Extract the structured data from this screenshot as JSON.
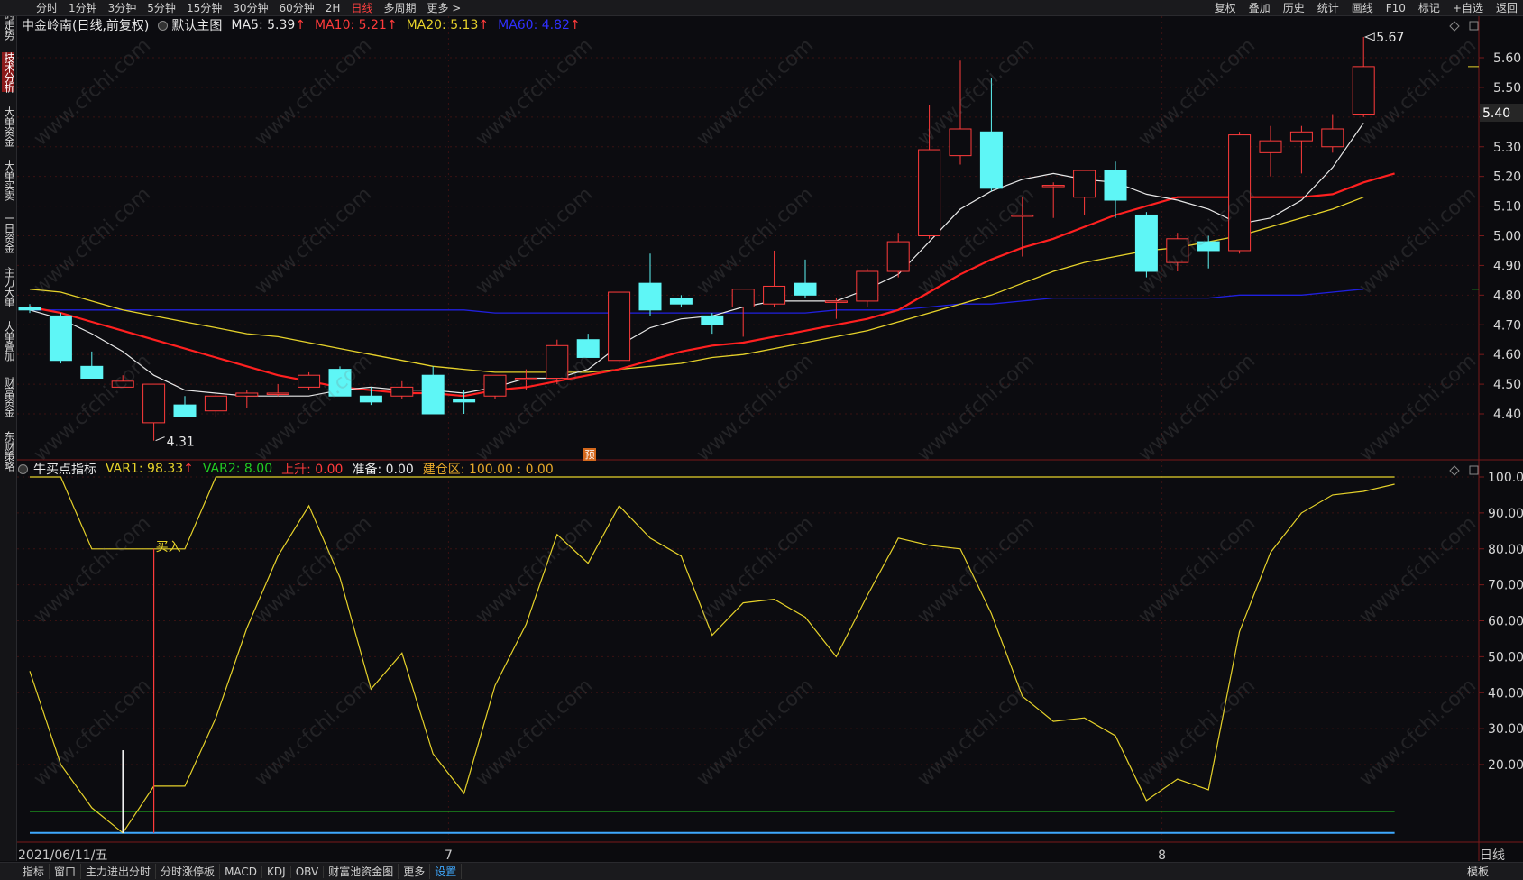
{
  "left_sidebar": [
    {
      "label": "分时走势",
      "active": false
    },
    {
      "label": "技术分析",
      "active": true
    },
    {
      "label": "大单资金",
      "active": false
    },
    {
      "label": "大单买卖",
      "active": false
    },
    {
      "label": "一日资金",
      "active": false
    },
    {
      "label": "主力大单",
      "active": false
    },
    {
      "label": "大单叠加",
      "active": false
    },
    {
      "label": "财富资金",
      "active": false
    },
    {
      "label": "东财策略",
      "active": false
    }
  ],
  "top_tabs": [
    {
      "label": "分时",
      "active": false
    },
    {
      "label": "1分钟",
      "active": false
    },
    {
      "label": "3分钟",
      "active": false
    },
    {
      "label": "5分钟",
      "active": false
    },
    {
      "label": "15分钟",
      "active": false
    },
    {
      "label": "30分钟",
      "active": false
    },
    {
      "label": "60分钟",
      "active": false
    },
    {
      "label": "2H",
      "active": false
    },
    {
      "label": "日线",
      "active": true
    },
    {
      "label": "多周期",
      "active": false
    },
    {
      "label": "更多 >",
      "active": false
    }
  ],
  "top_right": [
    "复权",
    "叠加",
    "历史",
    "统计",
    "画线",
    "F10",
    "标记",
    "+自选",
    "返回"
  ],
  "main_header": {
    "title": "中金岭南(日线,前复权)",
    "template": "默认主图",
    "ma5": "MA5: 5.39",
    "ma10": "MA10: 5.21",
    "ma20": "MA20: 5.13",
    "ma60": "MA60: 4.82",
    "arrow": "↑"
  },
  "indicator_header": {
    "name": "牛买点指标",
    "var1": "VAR1: 98.33",
    "var2": "VAR2: 8.00",
    "up": "上升: 0.00",
    "prep": "准备: 0.00",
    "build": "建仓区: 100.00 : 0.00",
    "arrow": "↑"
  },
  "annotations": {
    "high_label": "5.67",
    "low_label": "4.31",
    "current_price": "5.40",
    "pred_tag": "预",
    "buy_label": "买入"
  },
  "x_axis": {
    "start_date": "2021/06/11/五",
    "month_labels": [
      "7",
      "8"
    ],
    "period": "日线"
  },
  "bottom_tabs": [
    {
      "label": "指标",
      "active": false
    },
    {
      "label": "窗口",
      "active": false
    },
    {
      "label": "主力进出分时",
      "active": false
    },
    {
      "label": "分时涨停板",
      "active": false
    },
    {
      "label": "MACD",
      "active": false
    },
    {
      "label": "KDJ",
      "active": false
    },
    {
      "label": "OBV",
      "active": false
    },
    {
      "label": "财富池资金图",
      "active": false
    },
    {
      "label": "更多",
      "active": false
    },
    {
      "label": "设置",
      "active": true
    }
  ],
  "bottom_right": "模板",
  "watermark": "www.cfchi.com",
  "colors": {
    "up": "#ff3b3b",
    "down": "#5ef6f6",
    "ma5": "#e8e8e8",
    "ma10": "#ff2020",
    "ma20": "#e6d22a",
    "ma60": "#2020e0",
    "var1": "#e6d22a",
    "var2": "#22cc22",
    "build": "#3fa9ff"
  },
  "chart_data": [
    {
      "type": "candlestick",
      "title": "中金岭南(日线,前复权)",
      "y_ticks": [
        "5.60",
        "5.50",
        "5.40",
        "5.30",
        "5.20",
        "5.10",
        "5.00",
        "4.90",
        "4.80",
        "4.70",
        "4.60",
        "4.50",
        "4.40"
      ],
      "ylim": [
        4.25,
        5.7
      ],
      "candles": [
        {
          "o": 4.76,
          "h": 4.77,
          "l": 4.74,
          "c": 4.75
        },
        {
          "o": 4.73,
          "h": 4.74,
          "l": 4.57,
          "c": 4.58
        },
        {
          "o": 4.56,
          "h": 4.61,
          "l": 4.52,
          "c": 4.52
        },
        {
          "o": 4.49,
          "h": 4.53,
          "l": 4.49,
          "c": 4.51
        },
        {
          "o": 4.37,
          "h": 4.5,
          "l": 4.31,
          "c": 4.5
        },
        {
          "o": 4.43,
          "h": 4.46,
          "l": 4.39,
          "c": 4.39
        },
        {
          "o": 4.41,
          "h": 4.47,
          "l": 4.39,
          "c": 4.46
        },
        {
          "o": 4.46,
          "h": 4.48,
          "l": 4.42,
          "c": 4.47
        },
        {
          "o": 4.47,
          "h": 4.5,
          "l": 4.46,
          "c": 4.47
        },
        {
          "o": 4.49,
          "h": 4.54,
          "l": 4.48,
          "c": 4.53
        },
        {
          "o": 4.55,
          "h": 4.56,
          "l": 4.46,
          "c": 4.46
        },
        {
          "o": 4.46,
          "h": 4.49,
          "l": 4.43,
          "c": 4.44
        },
        {
          "o": 4.46,
          "h": 4.51,
          "l": 4.45,
          "c": 4.49
        },
        {
          "o": 4.53,
          "h": 4.56,
          "l": 4.4,
          "c": 4.4
        },
        {
          "o": 4.45,
          "h": 4.48,
          "l": 4.4,
          "c": 4.44
        },
        {
          "o": 4.46,
          "h": 4.52,
          "l": 4.45,
          "c": 4.53
        },
        {
          "o": 4.52,
          "h": 4.55,
          "l": 4.48,
          "c": 4.52
        },
        {
          "o": 4.52,
          "h": 4.65,
          "l": 4.5,
          "c": 4.63
        },
        {
          "o": 4.65,
          "h": 4.67,
          "l": 4.59,
          "c": 4.59
        },
        {
          "o": 4.58,
          "h": 4.81,
          "l": 4.57,
          "c": 4.81
        },
        {
          "o": 4.84,
          "h": 4.94,
          "l": 4.73,
          "c": 4.75
        },
        {
          "o": 4.79,
          "h": 4.8,
          "l": 4.76,
          "c": 4.77
        },
        {
          "o": 4.73,
          "h": 4.74,
          "l": 4.67,
          "c": 4.7
        },
        {
          "o": 4.76,
          "h": 4.82,
          "l": 4.66,
          "c": 4.82
        },
        {
          "o": 4.77,
          "h": 4.95,
          "l": 4.76,
          "c": 4.83
        },
        {
          "o": 4.84,
          "h": 4.92,
          "l": 4.79,
          "c": 4.8
        },
        {
          "o": 4.78,
          "h": 4.79,
          "l": 4.72,
          "c": 4.78
        },
        {
          "o": 4.78,
          "h": 4.89,
          "l": 4.76,
          "c": 4.88
        },
        {
          "o": 4.88,
          "h": 5.01,
          "l": 4.86,
          "c": 4.98
        },
        {
          "o": 5.0,
          "h": 5.44,
          "l": 4.99,
          "c": 5.29
        },
        {
          "o": 5.27,
          "h": 5.59,
          "l": 5.24,
          "c": 5.36
        },
        {
          "o": 5.35,
          "h": 5.53,
          "l": 5.15,
          "c": 5.16
        },
        {
          "o": 5.07,
          "h": 5.13,
          "l": 4.93,
          "c": 5.07
        },
        {
          "o": 5.17,
          "h": 5.18,
          "l": 5.06,
          "c": 5.17
        },
        {
          "o": 5.13,
          "h": 5.22,
          "l": 5.07,
          "c": 5.22
        },
        {
          "o": 5.22,
          "h": 5.25,
          "l": 5.06,
          "c": 5.12
        },
        {
          "o": 5.07,
          "h": 5.08,
          "l": 4.86,
          "c": 4.88
        },
        {
          "o": 4.91,
          "h": 5.01,
          "l": 4.88,
          "c": 4.99
        },
        {
          "o": 4.98,
          "h": 5.0,
          "l": 4.89,
          "c": 4.95
        },
        {
          "o": 4.95,
          "h": 5.35,
          "l": 4.94,
          "c": 5.34
        },
        {
          "o": 5.28,
          "h": 5.37,
          "l": 5.2,
          "c": 5.32
        },
        {
          "o": 5.32,
          "h": 5.37,
          "l": 5.21,
          "c": 5.35
        },
        {
          "o": 5.3,
          "h": 5.41,
          "l": 5.28,
          "c": 5.36
        },
        {
          "o": 5.41,
          "h": 5.67,
          "l": 5.4,
          "c": 5.57
        }
      ],
      "ma5": [
        4.75,
        4.72,
        4.67,
        4.61,
        4.53,
        4.48,
        4.47,
        4.46,
        4.46,
        4.46,
        4.48,
        4.49,
        4.48,
        4.48,
        4.47,
        4.49,
        4.52,
        4.52,
        4.55,
        4.63,
        4.69,
        4.72,
        4.73,
        4.76,
        4.78,
        4.78,
        4.78,
        4.82,
        4.87,
        4.98,
        5.09,
        5.15,
        5.19,
        5.21,
        5.19,
        5.18,
        5.14,
        5.12,
        5.09,
        5.04,
        5.06,
        5.12,
        5.23,
        5.38
      ],
      "ma10": [
        4.76,
        4.74,
        4.71,
        4.68,
        4.65,
        4.62,
        4.59,
        4.56,
        4.53,
        4.51,
        4.49,
        4.48,
        4.47,
        4.47,
        4.46,
        4.48,
        4.49,
        4.51,
        4.53,
        4.55,
        4.58,
        4.61,
        4.63,
        4.64,
        4.66,
        4.68,
        4.7,
        4.72,
        4.75,
        4.81,
        4.87,
        4.92,
        4.96,
        4.99,
        5.03,
        5.07,
        5.1,
        5.13,
        5.13,
        5.13,
        5.13,
        5.13,
        5.14,
        5.18,
        5.21
      ],
      "ma20": [
        4.82,
        4.81,
        4.78,
        4.75,
        4.73,
        4.71,
        4.69,
        4.67,
        4.66,
        4.64,
        4.62,
        4.6,
        4.58,
        4.56,
        4.55,
        4.54,
        4.54,
        4.54,
        4.54,
        4.55,
        4.56,
        4.57,
        4.59,
        4.6,
        4.62,
        4.64,
        4.66,
        4.68,
        4.71,
        4.74,
        4.77,
        4.8,
        4.84,
        4.88,
        4.91,
        4.93,
        4.95,
        4.96,
        4.98,
        5.0,
        5.03,
        5.06,
        5.09,
        5.13
      ],
      "ma60": [
        4.75,
        4.75,
        4.75,
        4.75,
        4.75,
        4.75,
        4.75,
        4.75,
        4.75,
        4.75,
        4.75,
        4.75,
        4.75,
        4.75,
        4.75,
        4.74,
        4.74,
        4.74,
        4.74,
        4.74,
        4.74,
        4.74,
        4.74,
        4.74,
        4.74,
        4.74,
        4.75,
        4.75,
        4.75,
        4.76,
        4.77,
        4.77,
        4.78,
        4.79,
        4.79,
        4.79,
        4.79,
        4.79,
        4.79,
        4.8,
        4.8,
        4.8,
        4.81,
        4.82
      ]
    },
    {
      "type": "line",
      "title": "牛买点指标",
      "y_ticks": [
        "100.0",
        "90.00",
        "80.00",
        "70.00",
        "60.00",
        "50.00",
        "40.00",
        "30.00",
        "20.00"
      ],
      "ylim": [
        0,
        100
      ],
      "series": [
        {
          "name": "VAR1",
          "values": [
            46,
            20,
            8,
            1,
            14,
            14,
            33,
            58,
            78,
            92,
            72,
            41,
            51,
            23,
            12,
            42,
            59,
            84,
            76,
            92,
            83,
            78,
            56,
            65,
            66,
            61,
            50,
            67,
            83,
            81,
            80,
            62,
            39,
            32,
            33,
            28,
            10,
            16,
            13,
            57,
            79,
            90,
            95,
            96,
            98
          ]
        },
        {
          "name": "VAR2",
          "values": [
            7,
            7,
            7,
            7,
            7,
            7,
            7,
            7,
            7,
            7,
            7,
            7,
            7,
            7,
            7,
            7,
            7,
            7,
            7,
            7,
            7,
            7,
            7,
            7,
            7,
            7,
            7,
            7,
            7,
            7,
            7,
            7,
            7,
            7,
            7,
            7,
            7,
            7,
            7,
            7,
            7,
            7,
            7,
            7,
            7
          ]
        },
        {
          "name": "建仓区",
          "values": [
            0,
            0,
            0,
            0,
            0,
            0,
            0,
            0,
            0,
            0,
            0,
            0,
            0,
            0,
            0,
            0,
            0,
            0,
            0,
            0,
            0,
            0,
            0,
            0,
            0,
            0,
            0,
            0,
            0,
            0,
            0,
            0,
            0,
            0,
            0,
            0,
            0,
            0,
            0,
            0,
            0,
            0,
            0,
            0,
            0
          ]
        },
        {
          "name": "upper",
          "values": [
            100,
            100,
            80,
            80,
            80,
            80,
            100,
            100,
            100,
            100,
            100,
            100,
            100,
            100,
            100,
            100,
            100,
            100,
            100,
            100,
            100,
            100,
            100,
            100,
            100,
            100,
            100,
            100,
            100,
            100,
            100,
            100,
            100,
            100,
            100,
            100,
            100,
            100,
            100,
            100,
            100,
            100,
            100,
            100,
            100
          ]
        }
      ]
    }
  ]
}
